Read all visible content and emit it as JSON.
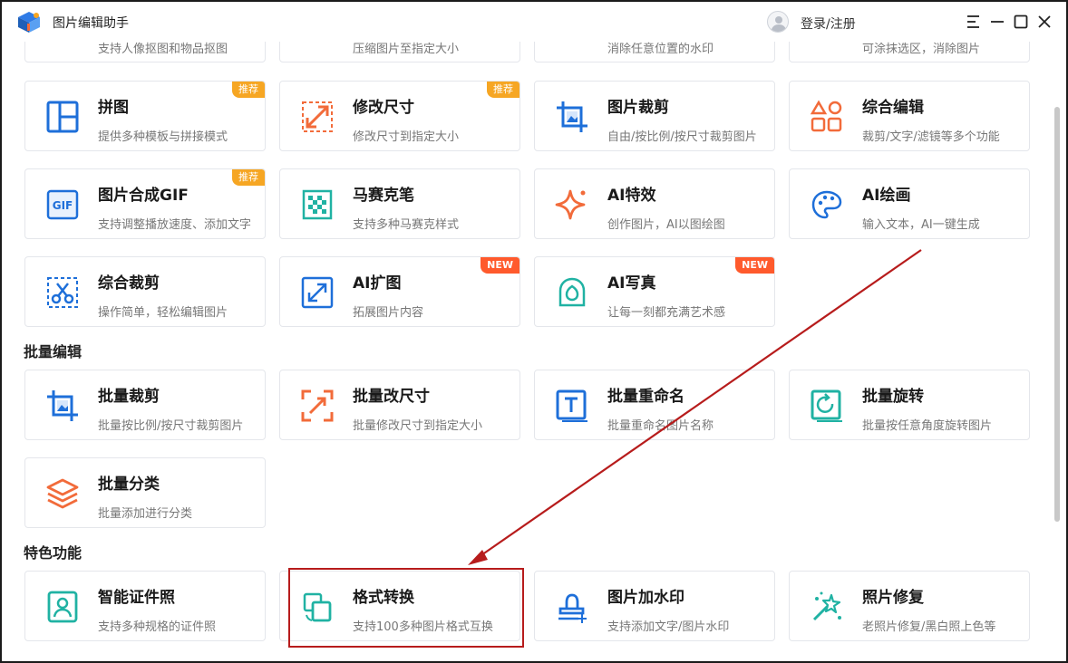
{
  "app": {
    "title": "图片编辑助手",
    "login_label": "登录/注册"
  },
  "window_controls": [
    "menu-icon",
    "minimize-icon",
    "maximize-icon",
    "close-icon"
  ],
  "top_partial_row": [
    {
      "desc": "支持人像抠图和物品抠图"
    },
    {
      "desc": "压缩图片至指定大小"
    },
    {
      "desc": "消除任意位置的水印"
    },
    {
      "desc": "可涂抹选区，消除图片"
    }
  ],
  "tools": [
    {
      "name": "拼图",
      "desc": "提供多种模板与拼接模式",
      "badge": "推荐",
      "icon": "collage-icon"
    },
    {
      "name": "修改尺寸",
      "desc": "修改尺寸到指定大小",
      "badge": "推荐",
      "icon": "resize-icon"
    },
    {
      "name": "图片裁剪",
      "desc": "自由/按比例/按尺寸裁剪图片",
      "badge": "",
      "icon": "crop-icon"
    },
    {
      "name": "综合编辑",
      "desc": "裁剪/文字/滤镜等多个功能",
      "badge": "",
      "icon": "shapes-icon"
    },
    {
      "name": "图片合成GIF",
      "desc": "支持调整播放速度、添加文字",
      "badge": "推荐",
      "icon": "gif-icon"
    },
    {
      "name": "马赛克笔",
      "desc": "支持多种马赛克样式",
      "badge": "",
      "icon": "mosaic-icon"
    },
    {
      "name": "AI特效",
      "desc": "创作图片，AI以图绘图",
      "badge": "",
      "icon": "sparkle-icon"
    },
    {
      "name": "AI绘画",
      "desc": "输入文本，AI一键生成",
      "badge": "",
      "icon": "palette-icon"
    },
    {
      "name": "综合裁剪",
      "desc": "操作简单，轻松编辑图片",
      "badge": "",
      "icon": "scissors-icon"
    },
    {
      "name": "AI扩图",
      "desc": "拓展图片内容",
      "badge": "NEW",
      "icon": "expand-icon"
    },
    {
      "name": "AI写真",
      "desc": "让每一刻都充满艺术感",
      "badge": "NEW",
      "icon": "portrait-icon"
    }
  ],
  "sections": {
    "batch": {
      "title": "批量编辑",
      "items": [
        {
          "name": "批量裁剪",
          "desc": "批量按比例/按尺寸裁剪图片",
          "icon": "batch-crop-icon"
        },
        {
          "name": "批量改尺寸",
          "desc": "批量修改尺寸到指定大小",
          "icon": "batch-resize-icon"
        },
        {
          "name": "批量重命名",
          "desc": "批量重命名图片名称",
          "icon": "rename-icon"
        },
        {
          "name": "批量旋转",
          "desc": "批量按任意角度旋转图片",
          "icon": "rotate-icon"
        },
        {
          "name": "批量分类",
          "desc": "批量添加进行分类",
          "icon": "layers-icon"
        }
      ]
    },
    "featured": {
      "title": "特色功能",
      "items": [
        {
          "name": "智能证件照",
          "desc": "支持多种规格的证件照",
          "icon": "id-photo-icon"
        },
        {
          "name": "格式转换",
          "desc": "支持100多种图片格式互换",
          "icon": "convert-icon"
        },
        {
          "name": "图片加水印",
          "desc": "支持添加文字/图片水印",
          "icon": "watermark-icon"
        },
        {
          "name": "照片修复",
          "desc": "老照片修复/黑白照上色等",
          "icon": "magic-wand-icon"
        }
      ]
    }
  },
  "colors": {
    "blue": "#1e6fd9",
    "orange": "#f26b3a",
    "teal": "#20b2a3",
    "badge_rec": "#f6a623",
    "badge_new": "#ff5a2c",
    "highlight": "#b71c1c"
  }
}
